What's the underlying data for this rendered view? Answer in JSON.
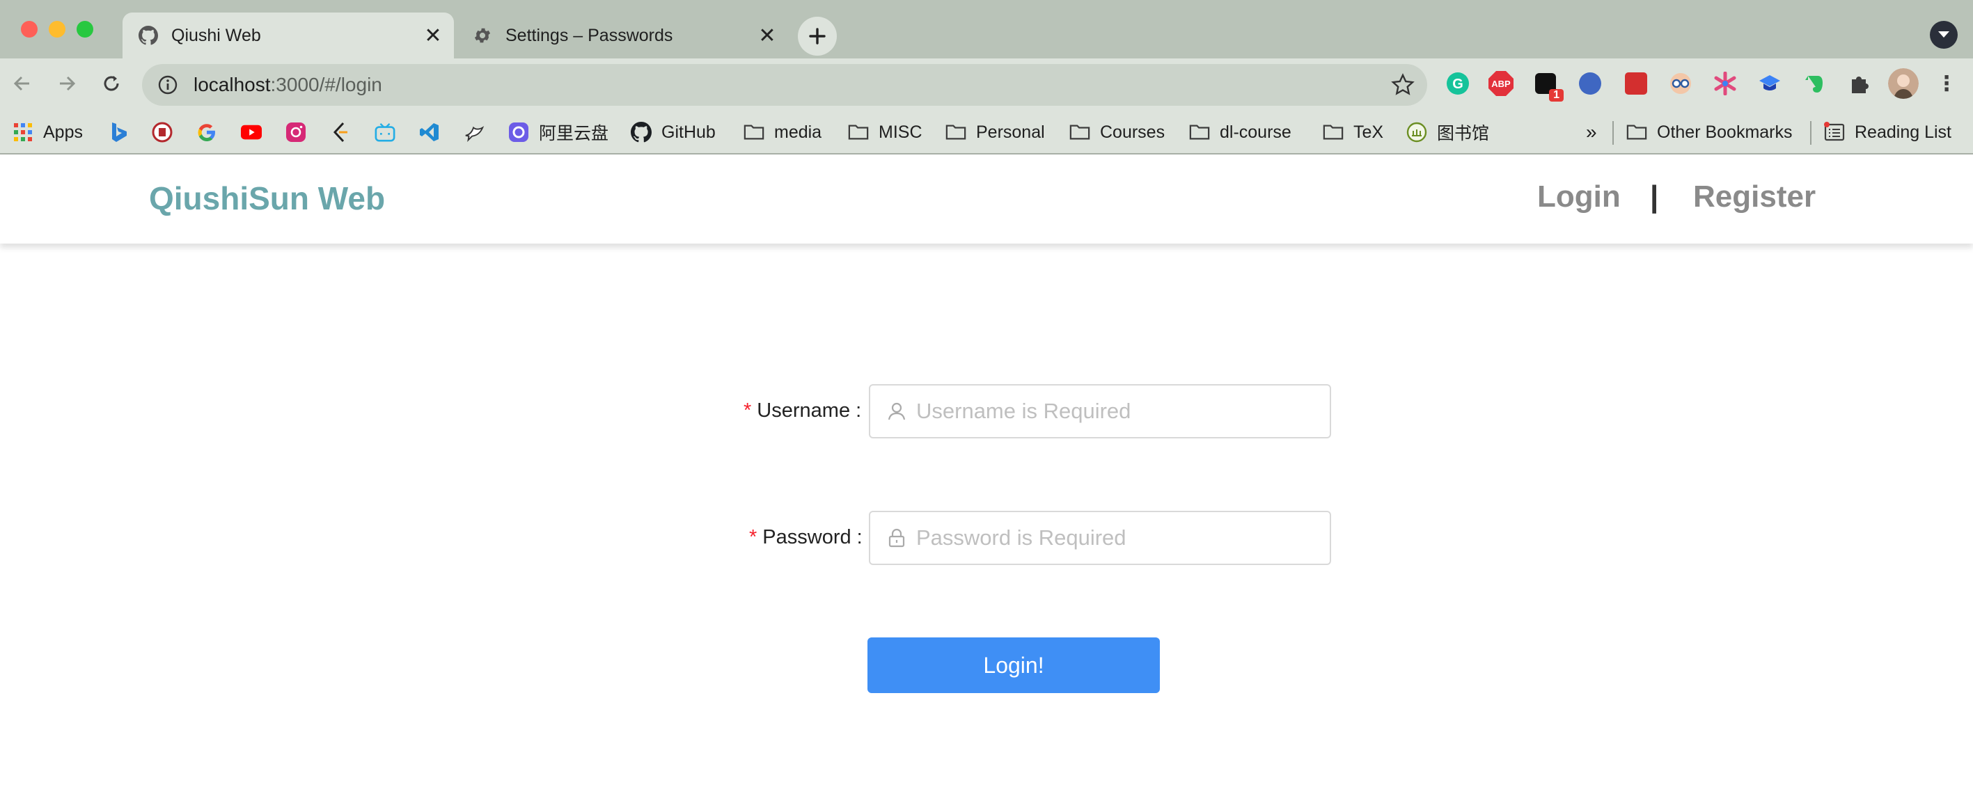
{
  "browser": {
    "tabs": [
      {
        "title": "Qiushi Web",
        "active": true,
        "icon": "github-icon"
      },
      {
        "title": "Settings – Passwords",
        "active": false,
        "icon": "gear-icon"
      }
    ],
    "url_host": "localhost",
    "url_rest": ":3000/#/login",
    "bookmarks": [
      {
        "label": "Apps",
        "icon": "apps-grid-icon"
      },
      {
        "label": "",
        "icon": "bing-icon"
      },
      {
        "label": "",
        "icon": "seal-icon"
      },
      {
        "label": "",
        "icon": "google-icon"
      },
      {
        "label": "",
        "icon": "youtube-icon"
      },
      {
        "label": "",
        "icon": "instagram-icon"
      },
      {
        "label": "",
        "icon": "leetcode-icon"
      },
      {
        "label": "",
        "icon": "bilibili-icon"
      },
      {
        "label": "",
        "icon": "vscode-icon"
      },
      {
        "label": "",
        "icon": "bird-icon"
      },
      {
        "label": "阿里云盘",
        "icon": "aliyun-drive-icon"
      },
      {
        "label": "GitHub",
        "icon": "github-icon"
      },
      {
        "label": "media",
        "icon": "folder-icon"
      },
      {
        "label": "MISC",
        "icon": "folder-icon"
      },
      {
        "label": "Personal",
        "icon": "folder-icon"
      },
      {
        "label": "Courses",
        "icon": "folder-icon"
      },
      {
        "label": "dl-course",
        "icon": "folder-icon"
      },
      {
        "label": "TeX",
        "icon": "folder-icon"
      },
      {
        "label": "图书馆",
        "icon": "library-icon"
      }
    ],
    "overflow_label": "»",
    "other_bookmarks": "Other Bookmarks",
    "reading_list": "Reading List",
    "extension_badge": "1",
    "abp_label": "ABP"
  },
  "site": {
    "brand": "QiushiSun Web",
    "nav_login": "Login",
    "nav_separator": "|",
    "nav_register": "Register"
  },
  "login_form": {
    "required_marker": "*",
    "username_label": "Username :",
    "username_placeholder": "Username is Required",
    "password_label": "Password :",
    "password_placeholder": "Password is Required",
    "submit_label": "Login!"
  },
  "colors": {
    "brand": "#6aa6ab",
    "primary_button": "#3f8ff5",
    "required": "#f5222d"
  }
}
